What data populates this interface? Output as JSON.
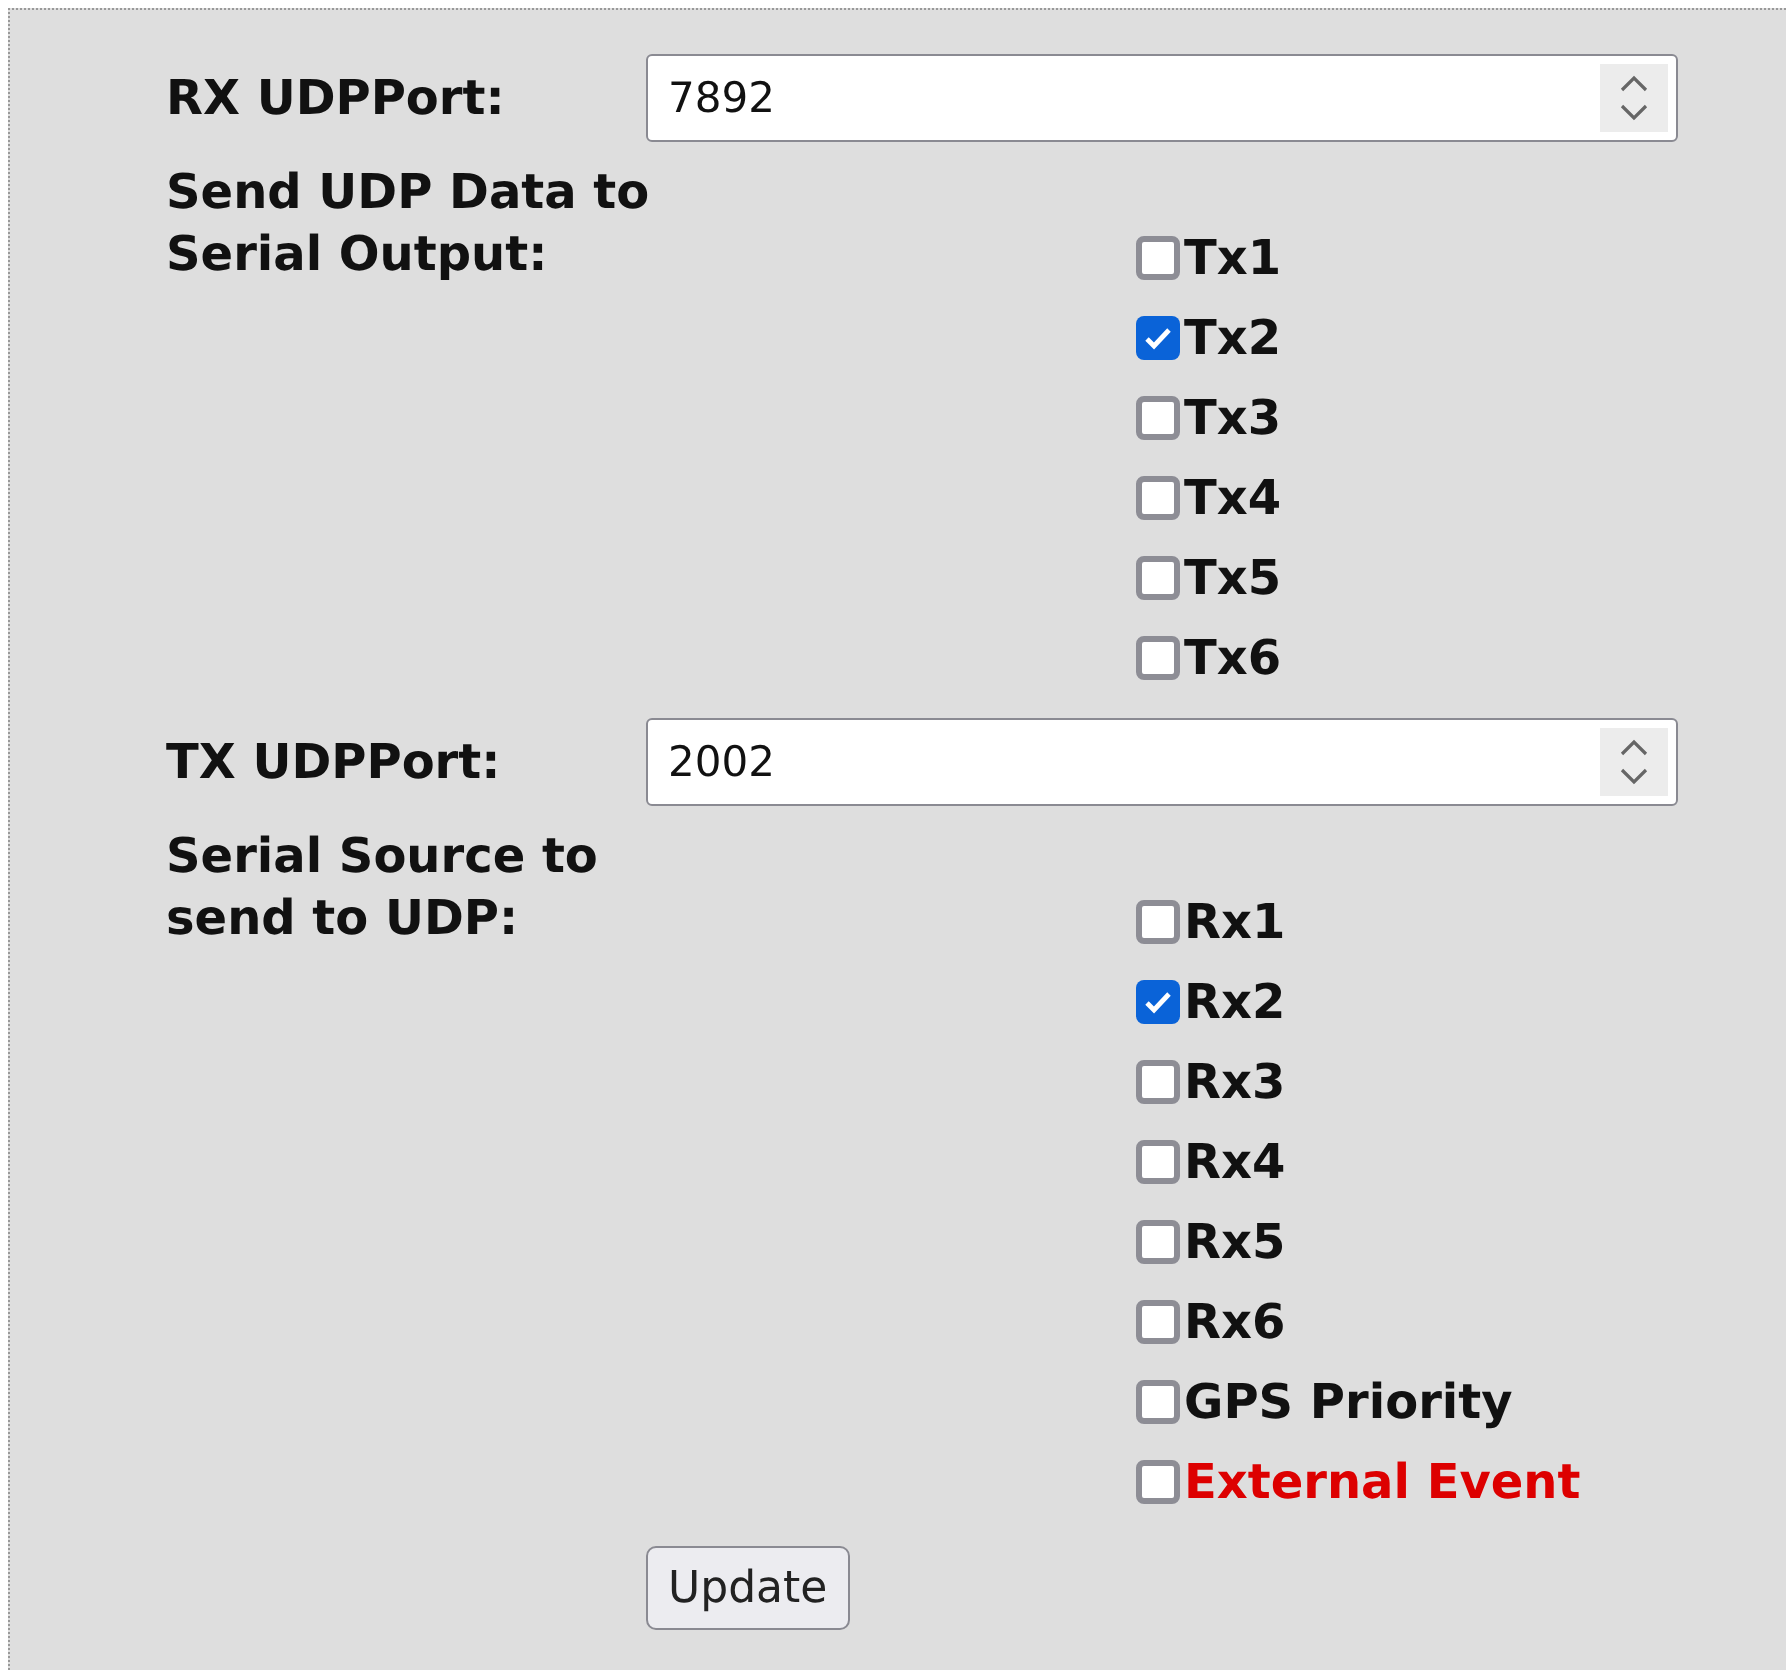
{
  "sections": [
    {
      "kind": "number",
      "label": "RX UDPPort:",
      "value": "7892"
    },
    {
      "kind": "checklist",
      "label": "Send UDP Data to Serial Output:",
      "options": [
        {
          "label": "Tx1",
          "checked": false
        },
        {
          "label": "Tx2",
          "checked": true
        },
        {
          "label": "Tx3",
          "checked": false
        },
        {
          "label": "Tx4",
          "checked": false
        },
        {
          "label": "Tx5",
          "checked": false
        },
        {
          "label": "Tx6",
          "checked": false
        }
      ]
    },
    {
      "kind": "number",
      "label": "TX UDPPort:",
      "value": "2002"
    },
    {
      "kind": "checklist",
      "label": "Serial Source to send to UDP:",
      "options": [
        {
          "label": "Rx1",
          "checked": false
        },
        {
          "label": "Rx2",
          "checked": true
        },
        {
          "label": "Rx3",
          "checked": false
        },
        {
          "label": "Rx4",
          "checked": false
        },
        {
          "label": "Rx5",
          "checked": false
        },
        {
          "label": "Rx6",
          "checked": false
        },
        {
          "label": "GPS Priority",
          "checked": false
        },
        {
          "label": "External Event",
          "checked": false,
          "color": "#dd0000"
        }
      ]
    }
  ],
  "button": "Update"
}
